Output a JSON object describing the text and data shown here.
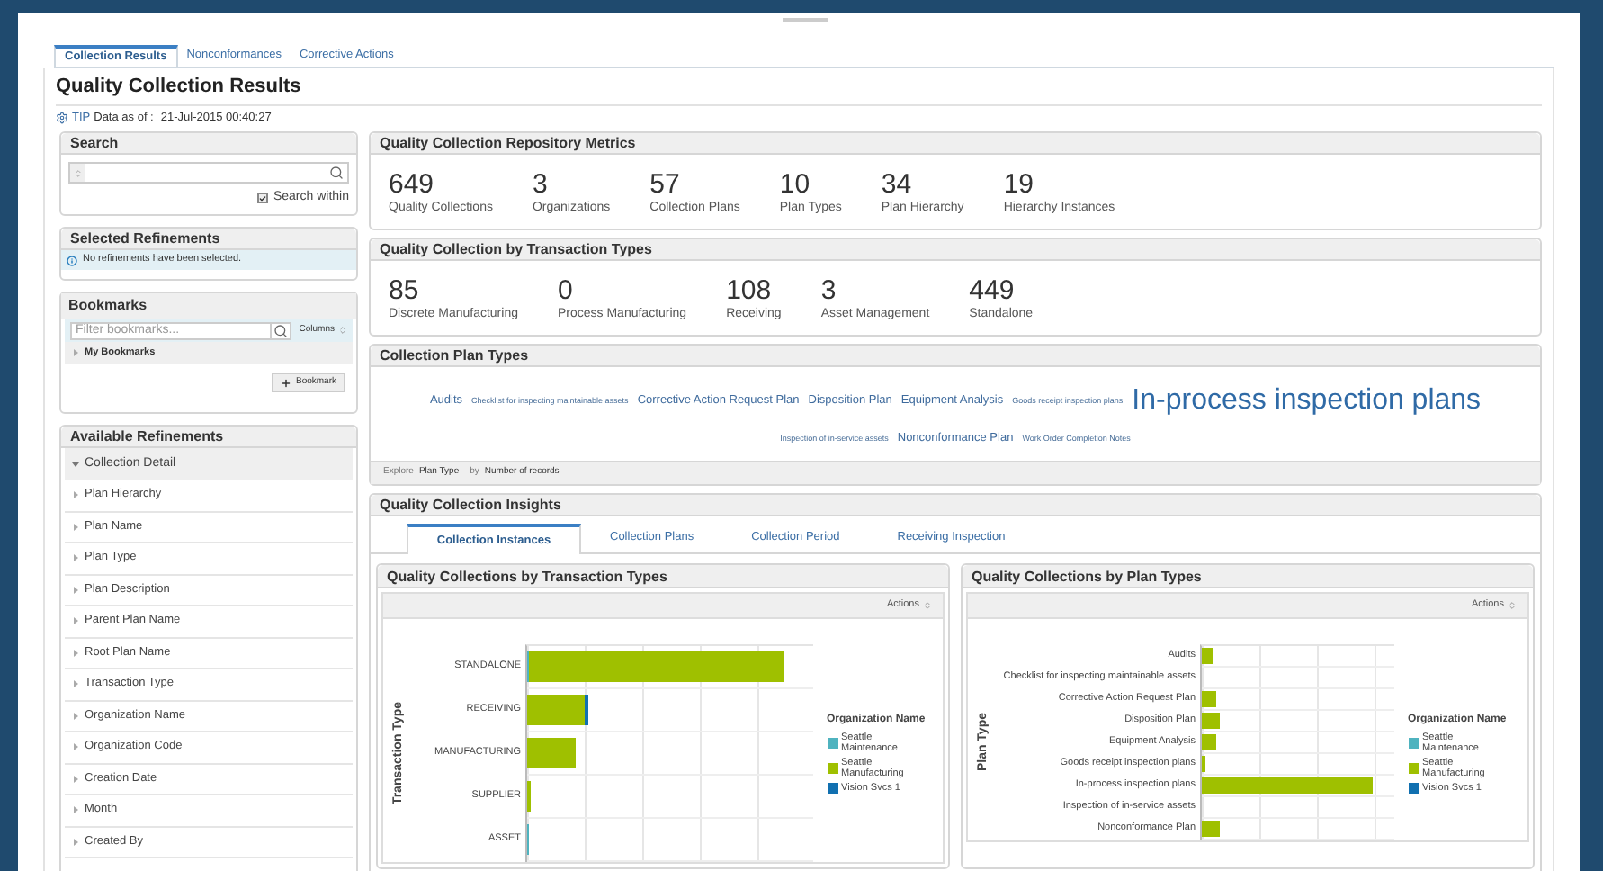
{
  "tabs": [
    {
      "label": "Collection Results",
      "selected": true
    },
    {
      "label": "Nonconformances",
      "selected": false
    },
    {
      "label": "Corrective Actions",
      "selected": false
    }
  ],
  "title": "Quality Collection Results",
  "tip": {
    "label": "TIP",
    "text": "Data as of :",
    "date": "21-Jul-2015 00:40:27"
  },
  "search": {
    "title": "Search",
    "within_label": "Search within",
    "within_checked": true
  },
  "selected_refinements": {
    "title": "Selected Refinements",
    "message": "No refinements have been selected."
  },
  "bookmarks": {
    "title": "Bookmarks",
    "placeholder": "Filter bookmarks...",
    "columns": "Columns",
    "group": "My Bookmarks",
    "add_button": "Bookmark"
  },
  "available_refinements": {
    "title": "Available Refinements",
    "group": "Collection Detail",
    "expanded": true,
    "items": [
      "Plan Hierarchy",
      "Plan Name",
      "Plan Type",
      "Plan Description",
      "Parent Plan Name",
      "Root Plan Name",
      "Transaction Type",
      "Organization Name",
      "Organization Code",
      "Creation Date",
      "Month",
      "Created By"
    ]
  },
  "repository_metrics": {
    "title": "Quality Collection Repository Metrics",
    "metrics": [
      {
        "value": "649",
        "label": "Quality Collections"
      },
      {
        "value": "3",
        "label": "Organizations"
      },
      {
        "value": "57",
        "label": "Collection Plans"
      },
      {
        "value": "10",
        "label": "Plan Types"
      },
      {
        "value": "34",
        "label": "Plan Hierarchy"
      },
      {
        "value": "19",
        "label": "Hierarchy Instances"
      }
    ]
  },
  "transaction_types": {
    "title": "Quality Collection by Transaction Types",
    "metrics": [
      {
        "value": "85",
        "label": "Discrete Manufacturing"
      },
      {
        "value": "0",
        "label": "Process Manufacturing"
      },
      {
        "value": "108",
        "label": "Receiving"
      },
      {
        "value": "3",
        "label": "Asset Management"
      },
      {
        "value": "449",
        "label": "Standalone"
      }
    ]
  },
  "plan_types": {
    "title": "Collection Plan Types",
    "tags": [
      {
        "label": "Audits",
        "kind": "medium"
      },
      {
        "label": "Checklist for inspecting maintainable assets",
        "kind": "small"
      },
      {
        "label": "Corrective Action Request Plan",
        "kind": "medium"
      },
      {
        "label": "Disposition Plan",
        "kind": "medium"
      },
      {
        "label": "Equipment Analysis",
        "kind": "medium"
      },
      {
        "label": "Goods receipt inspection plans",
        "kind": "small"
      },
      {
        "label": "In-process inspection plans",
        "kind": "large"
      },
      {
        "label": "Inspection of in-service assets",
        "kind": "small"
      },
      {
        "label": "Nonconformance Plan",
        "kind": "medium"
      },
      {
        "label": "Work Order Completion Notes",
        "kind": "small"
      }
    ],
    "footer": {
      "explore": "Explore",
      "dimension": "Plan Type",
      "by": "by",
      "measure": "Number of records"
    }
  },
  "insights": {
    "title": "Quality Collection Insights",
    "tabs": [
      {
        "label": "Collection Instances",
        "selected": true
      },
      {
        "label": "Collection Plans",
        "selected": false
      },
      {
        "label": "Collection Period",
        "selected": false
      },
      {
        "label": "Receiving Inspection",
        "selected": false
      }
    ]
  },
  "charts": [
    {
      "title": "Quality Collections by Transaction Types",
      "actions": "Actions",
      "axis_label": "Transaction Type",
      "categories": [
        "STANDALONE",
        "RECEIVING",
        "MANUFACTURING",
        "SUPPLIER",
        "ASSET"
      ],
      "legend_title": "Organization Name",
      "legend": [
        {
          "label": "Seattle Maintenance",
          "color": "#4fb3bf"
        },
        {
          "label": "Seattle Manufacturing",
          "color": "#9fc000"
        },
        {
          "label": "Vision Svcs 1",
          "color": "#1170b0"
        }
      ]
    },
    {
      "title": "Quality Collections by Plan Types",
      "actions": "Actions",
      "axis_label": "Plan Type",
      "categories": [
        "Audits",
        "Checklist for inspecting maintainable assets",
        "Corrective Action Request Plan",
        "Disposition Plan",
        "Equipment Analysis",
        "Goods receipt inspection plans",
        "In-process inspection plans",
        "Inspection of in-service assets",
        "Nonconformance Plan"
      ],
      "legend_title": "Organization Name",
      "legend": [
        {
          "label": "Seattle Maintenance",
          "color": "#4fb3bf"
        },
        {
          "label": "Seattle Manufacturing",
          "color": "#9fc000"
        },
        {
          "label": "Vision Svcs 1",
          "color": "#1170b0"
        }
      ]
    }
  ]
}
